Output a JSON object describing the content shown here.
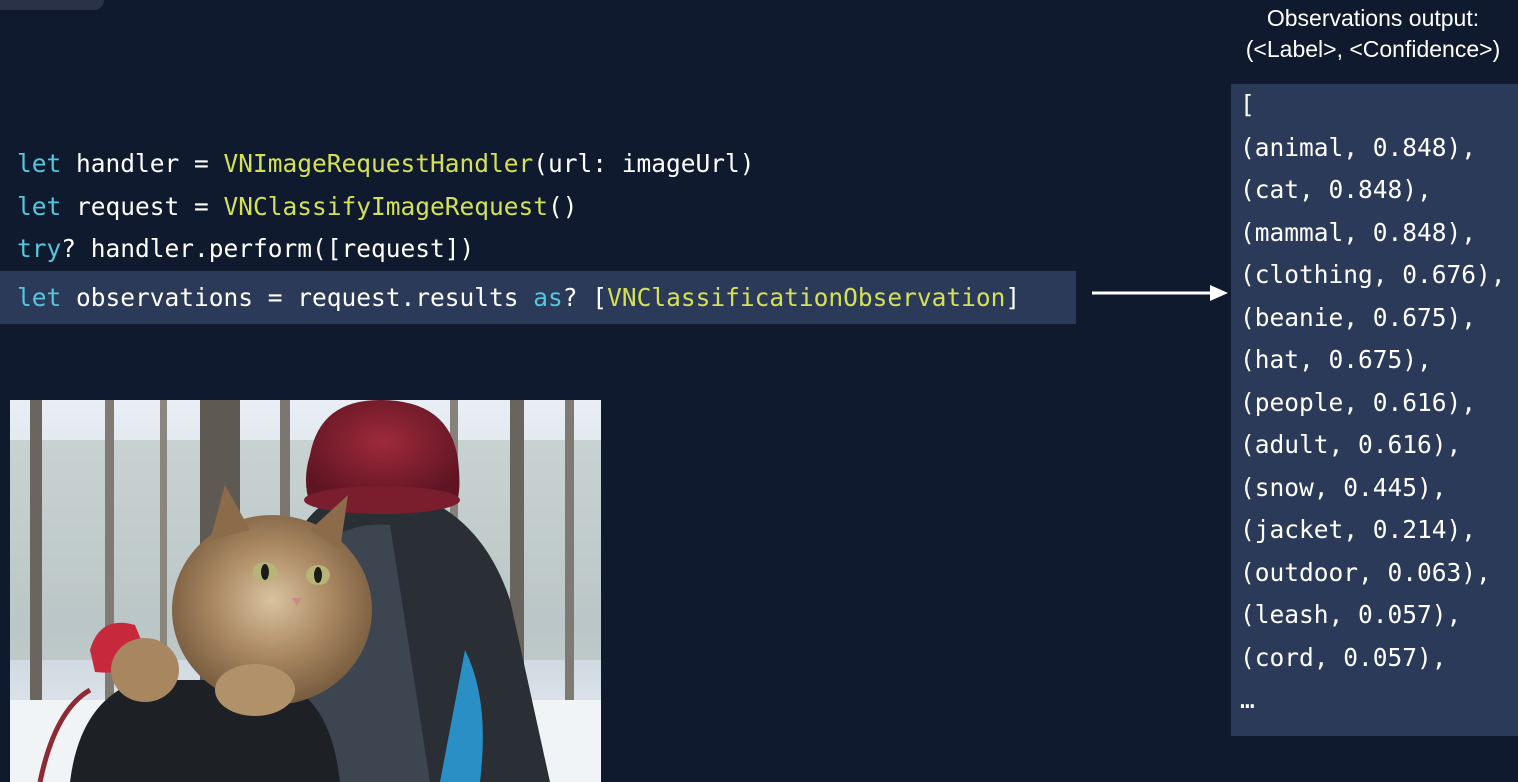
{
  "code": {
    "lines": [
      [
        {
          "t": "let",
          "c": "kw"
        },
        {
          "t": " handler = ",
          "c": ""
        },
        {
          "t": "VNImageRequestHandler",
          "c": "cls"
        },
        {
          "t": "(url: imageUrl)",
          "c": ""
        }
      ],
      [
        {
          "t": "let",
          "c": "kw"
        },
        {
          "t": " request = ",
          "c": ""
        },
        {
          "t": "VNClassifyImageRequest",
          "c": "cls"
        },
        {
          "t": "()",
          "c": ""
        }
      ],
      [
        {
          "t": "try",
          "c": "kw"
        },
        {
          "t": "? handler.perform([request])",
          "c": ""
        }
      ],
      [
        {
          "t": "let",
          "c": "kw"
        },
        {
          "t": " observations = request.results ",
          "c": ""
        },
        {
          "t": "as",
          "c": "kw"
        },
        {
          "t": "? [",
          "c": ""
        },
        {
          "t": "VNClassificationObservation",
          "c": "cls"
        },
        {
          "t": "]",
          "c": ""
        }
      ]
    ],
    "highlighted_line": 3
  },
  "output": {
    "title_line1": "Observations output:",
    "title_line2": "(<Label>, <Confidence>)",
    "lines": [
      "[",
      "(animal, 0.848),",
      "(cat, 0.848),",
      "(mammal, 0.848),",
      "(clothing, 0.676),",
      "(beanie, 0.675),",
      "(hat, 0.675),",
      "(people, 0.616),",
      "(adult, 0.616),",
      "(snow, 0.445),",
      "(jacket, 0.214),",
      "(outdoor, 0.063),",
      "(leash, 0.057),",
      "(cord, 0.057),",
      "…"
    ]
  },
  "colors": {
    "background": "#101a2e",
    "highlight": "#2c3a5a",
    "keyword": "#55c6dc",
    "class_name": "#d4e157",
    "text": "#ffffff"
  },
  "photo": {
    "subject": "cat-in-backpack"
  }
}
